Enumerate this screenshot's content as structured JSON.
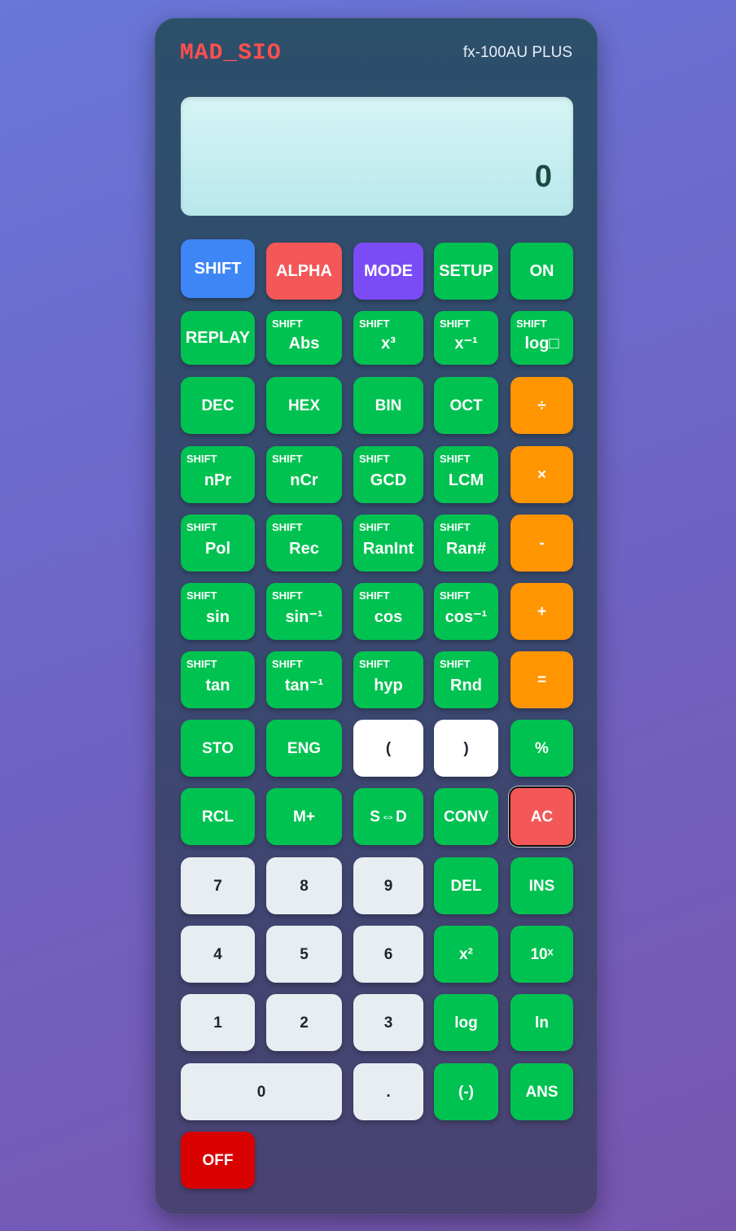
{
  "brand": "MAD_SIO",
  "model": "fx-100AU PLUS",
  "display": {
    "value": "0"
  },
  "keys": {
    "shift": "SHIFT",
    "alpha": "ALPHA",
    "mode": "MODE",
    "setup": "SETUP",
    "on": "ON",
    "replay": "REPLAY",
    "abs": "Abs",
    "cube": "x³",
    "inverse": "x⁻¹",
    "log_base": "log□",
    "dec": "DEC",
    "hex": "HEX",
    "bin": "BIN",
    "oct": "OCT",
    "divide": "÷",
    "npr": "nPr",
    "ncr": "nCr",
    "gcd": "GCD",
    "lcm": "LCM",
    "multiply": "×",
    "pol": "Pol",
    "rec": "Rec",
    "ranint": "RanInt",
    "ran": "Ran#",
    "minus": "-",
    "sin": "sin",
    "asin": "sin⁻¹",
    "cos": "cos",
    "acos": "cos⁻¹",
    "plus": "+",
    "tan": "tan",
    "atan": "tan⁻¹",
    "hyp": "hyp",
    "rnd": "Rnd",
    "equals": "=",
    "sto": "STO",
    "eng": "ENG",
    "lparen": "(",
    "rparen": ")",
    "percent": "%",
    "rcl": "RCL",
    "mplus": "M+",
    "sd": "S⇔D",
    "conv": "CONV",
    "ac": "AC",
    "n7": "7",
    "n8": "8",
    "n9": "9",
    "del": "DEL",
    "ins": "INS",
    "n4": "4",
    "n5": "5",
    "n6": "6",
    "square": "x²",
    "pow10": "10ˣ",
    "n1": "1",
    "n2": "2",
    "n3": "3",
    "log": "log",
    "ln": "ln",
    "n0": "0",
    "dot": ".",
    "neg": "(-)",
    "ans": "ANS",
    "off": "OFF"
  },
  "shift_tag": "SHIFT"
}
